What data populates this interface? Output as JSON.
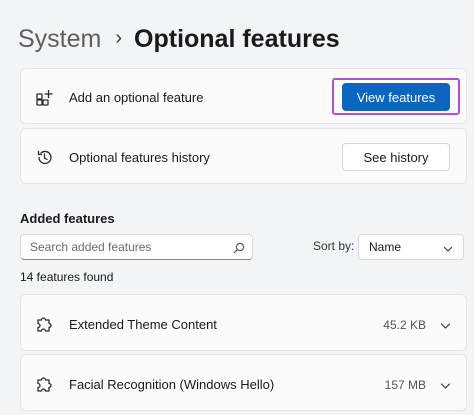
{
  "breadcrumb": {
    "parent": "System",
    "separator": "›",
    "title": "Optional features"
  },
  "add_feature": {
    "icon": "add-grid-icon",
    "label": "Add an optional feature",
    "button_label": "View features"
  },
  "history": {
    "icon": "history-icon",
    "label": "Optional features history",
    "button_label": "See history"
  },
  "added_features": {
    "heading": "Added features",
    "search_placeholder": "Search added features",
    "sort_label": "Sort by:",
    "sort_value": "Name",
    "count_text": "14 features found",
    "items": [
      {
        "icon": "puzzle-icon",
        "name": "Extended Theme Content",
        "size": "45.2 KB"
      },
      {
        "icon": "puzzle-icon",
        "name": "Facial Recognition (Windows Hello)",
        "size": "157 MB"
      }
    ]
  },
  "colors": {
    "accent": "#0a66c2",
    "highlight": "#b54bd6",
    "background": "#f3f4f8",
    "card": "#fbfbfc"
  }
}
